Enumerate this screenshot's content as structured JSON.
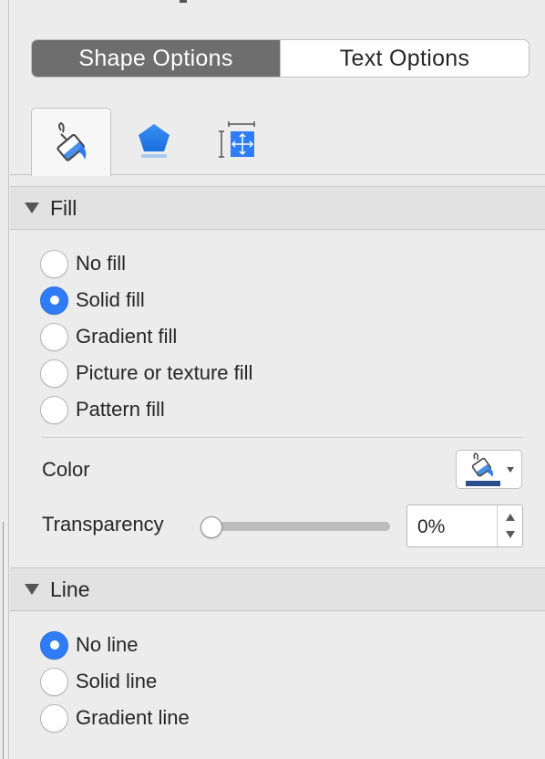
{
  "tabs": {
    "shape_options": "Shape Options",
    "text_options": "Text Options",
    "active": "shape_options"
  },
  "icon_tabs": [
    {
      "icon": "paint-bucket-icon",
      "selected": true
    },
    {
      "icon": "pentagon-icon",
      "selected": false
    },
    {
      "icon": "size-position-icon",
      "selected": false
    }
  ],
  "fill": {
    "title": "Fill",
    "options": [
      {
        "label": "No fill",
        "checked": false
      },
      {
        "label": "Solid fill",
        "checked": true
      },
      {
        "label": "Gradient fill",
        "checked": false
      },
      {
        "label": "Picture or texture fill",
        "checked": false
      },
      {
        "label": "Pattern fill",
        "checked": false
      }
    ],
    "color_label": "Color",
    "color_value": "#2b4e8f",
    "transparency_label": "Transparency",
    "transparency_value": "0%",
    "transparency_fraction": 0
  },
  "line": {
    "title": "Line",
    "options": [
      {
        "label": "No line",
        "checked": true
      },
      {
        "label": "Solid line",
        "checked": false
      },
      {
        "label": "Gradient line",
        "checked": false
      }
    ]
  },
  "colors": {
    "accent": "#2f7cf6",
    "segment_active": "#6e6e6e"
  }
}
